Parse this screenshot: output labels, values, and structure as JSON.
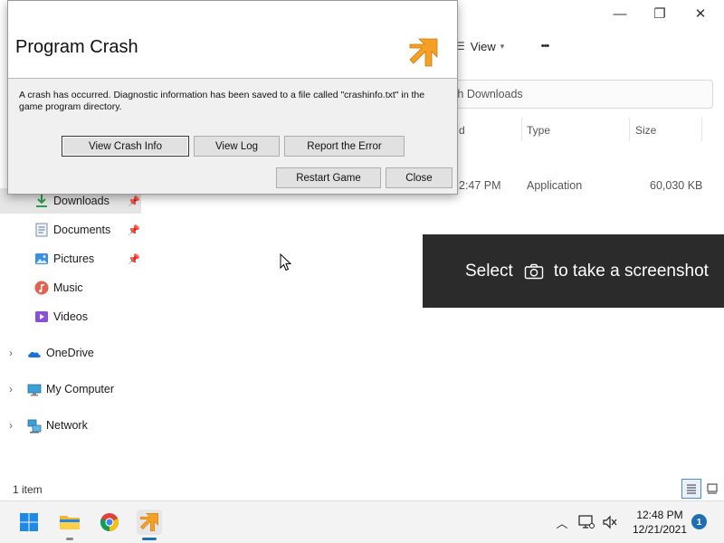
{
  "explorer": {
    "window_controls": {
      "minimize": "—",
      "maximize": "❐",
      "close": "✕"
    },
    "toolbar": {
      "view_label": "View",
      "more_label": "•••"
    },
    "search": {
      "placeholder": "rch Downloads"
    },
    "columns": [
      {
        "label": "d"
      },
      {
        "label": "Type"
      },
      {
        "label": "Size"
      }
    ],
    "row": {
      "time": "2:47 PM",
      "type": "Application",
      "size": "60,030 KB"
    },
    "nav": {
      "quick_access": [
        {
          "label": "Downloads",
          "icon": "download-icon",
          "pinned": true,
          "selected": true
        },
        {
          "label": "Documents",
          "icon": "document-icon",
          "pinned": true
        },
        {
          "label": "Pictures",
          "icon": "pictures-icon",
          "pinned": true
        },
        {
          "label": "Music",
          "icon": "music-icon",
          "pinned": false
        },
        {
          "label": "Videos",
          "icon": "videos-icon",
          "pinned": false
        }
      ],
      "roots": [
        {
          "label": "OneDrive",
          "icon": "onedrive-icon"
        },
        {
          "label": "My Computer",
          "icon": "computer-icon"
        },
        {
          "label": "Network",
          "icon": "network-icon"
        }
      ]
    },
    "status": {
      "item_count": "1 item"
    }
  },
  "snip_overlay": {
    "text_before": "Select",
    "text_after": "to take a screenshot"
  },
  "dialog": {
    "title": "Program Crash",
    "message": "A crash has occurred.  Diagnostic information has been saved to a file called \"crashinfo.txt\" in the game program directory.",
    "buttons": {
      "view_crash_info": "View Crash Info",
      "view_log": "View Log",
      "report_error": "Report the Error",
      "restart_game": "Restart Game",
      "close": "Close"
    },
    "colors": {
      "logo_orange": "#f5a024"
    }
  },
  "taskbar": {
    "clock_time": "12:48 PM",
    "clock_date": "12/21/2021",
    "notification_count": "1",
    "colors": {
      "accent": "#1f6fb4"
    }
  }
}
